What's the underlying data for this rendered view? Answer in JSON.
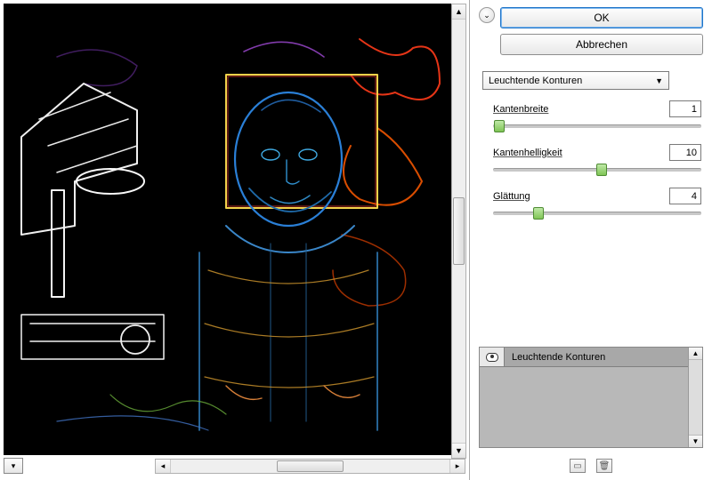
{
  "buttons": {
    "ok": "OK",
    "cancel": "Abbrechen"
  },
  "filter": {
    "selected": "Leuchtende Konturen"
  },
  "sliders": {
    "edge_width": {
      "label": "Kantenbreite",
      "value": "1",
      "pct": 3
    },
    "edge_bright": {
      "label": "Kantenhelligkeit",
      "value": "10",
      "pct": 52
    },
    "smoothing": {
      "label": "Glättung",
      "value": "4",
      "pct": 22
    }
  },
  "effect_list": {
    "items": [
      {
        "label": "Leuchtende Konturen",
        "visible": true
      }
    ]
  }
}
